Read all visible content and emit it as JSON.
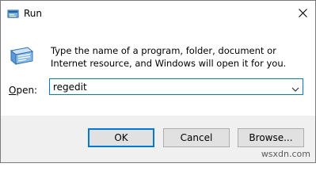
{
  "window": {
    "title": "Run",
    "title_icon": "run-icon",
    "close_icon": "close-icon"
  },
  "body": {
    "app_icon": "run-program-icon",
    "description": "Type the name of a program, folder, document or Internet resource, and Windows will open it for you.",
    "open_label_prefix": "O",
    "open_label_rest": "pen:",
    "open_value": "regedit",
    "dropdown_icon": "chevron-down-icon"
  },
  "buttons": {
    "ok_label": "OK",
    "cancel_label": "Cancel",
    "browse_label": "Browse..."
  },
  "watermark": "wsxdn.com",
  "colors": {
    "accent": "#0078d7",
    "footer_bg": "#f0f0f0",
    "button_bg": "#e1e1e1"
  }
}
